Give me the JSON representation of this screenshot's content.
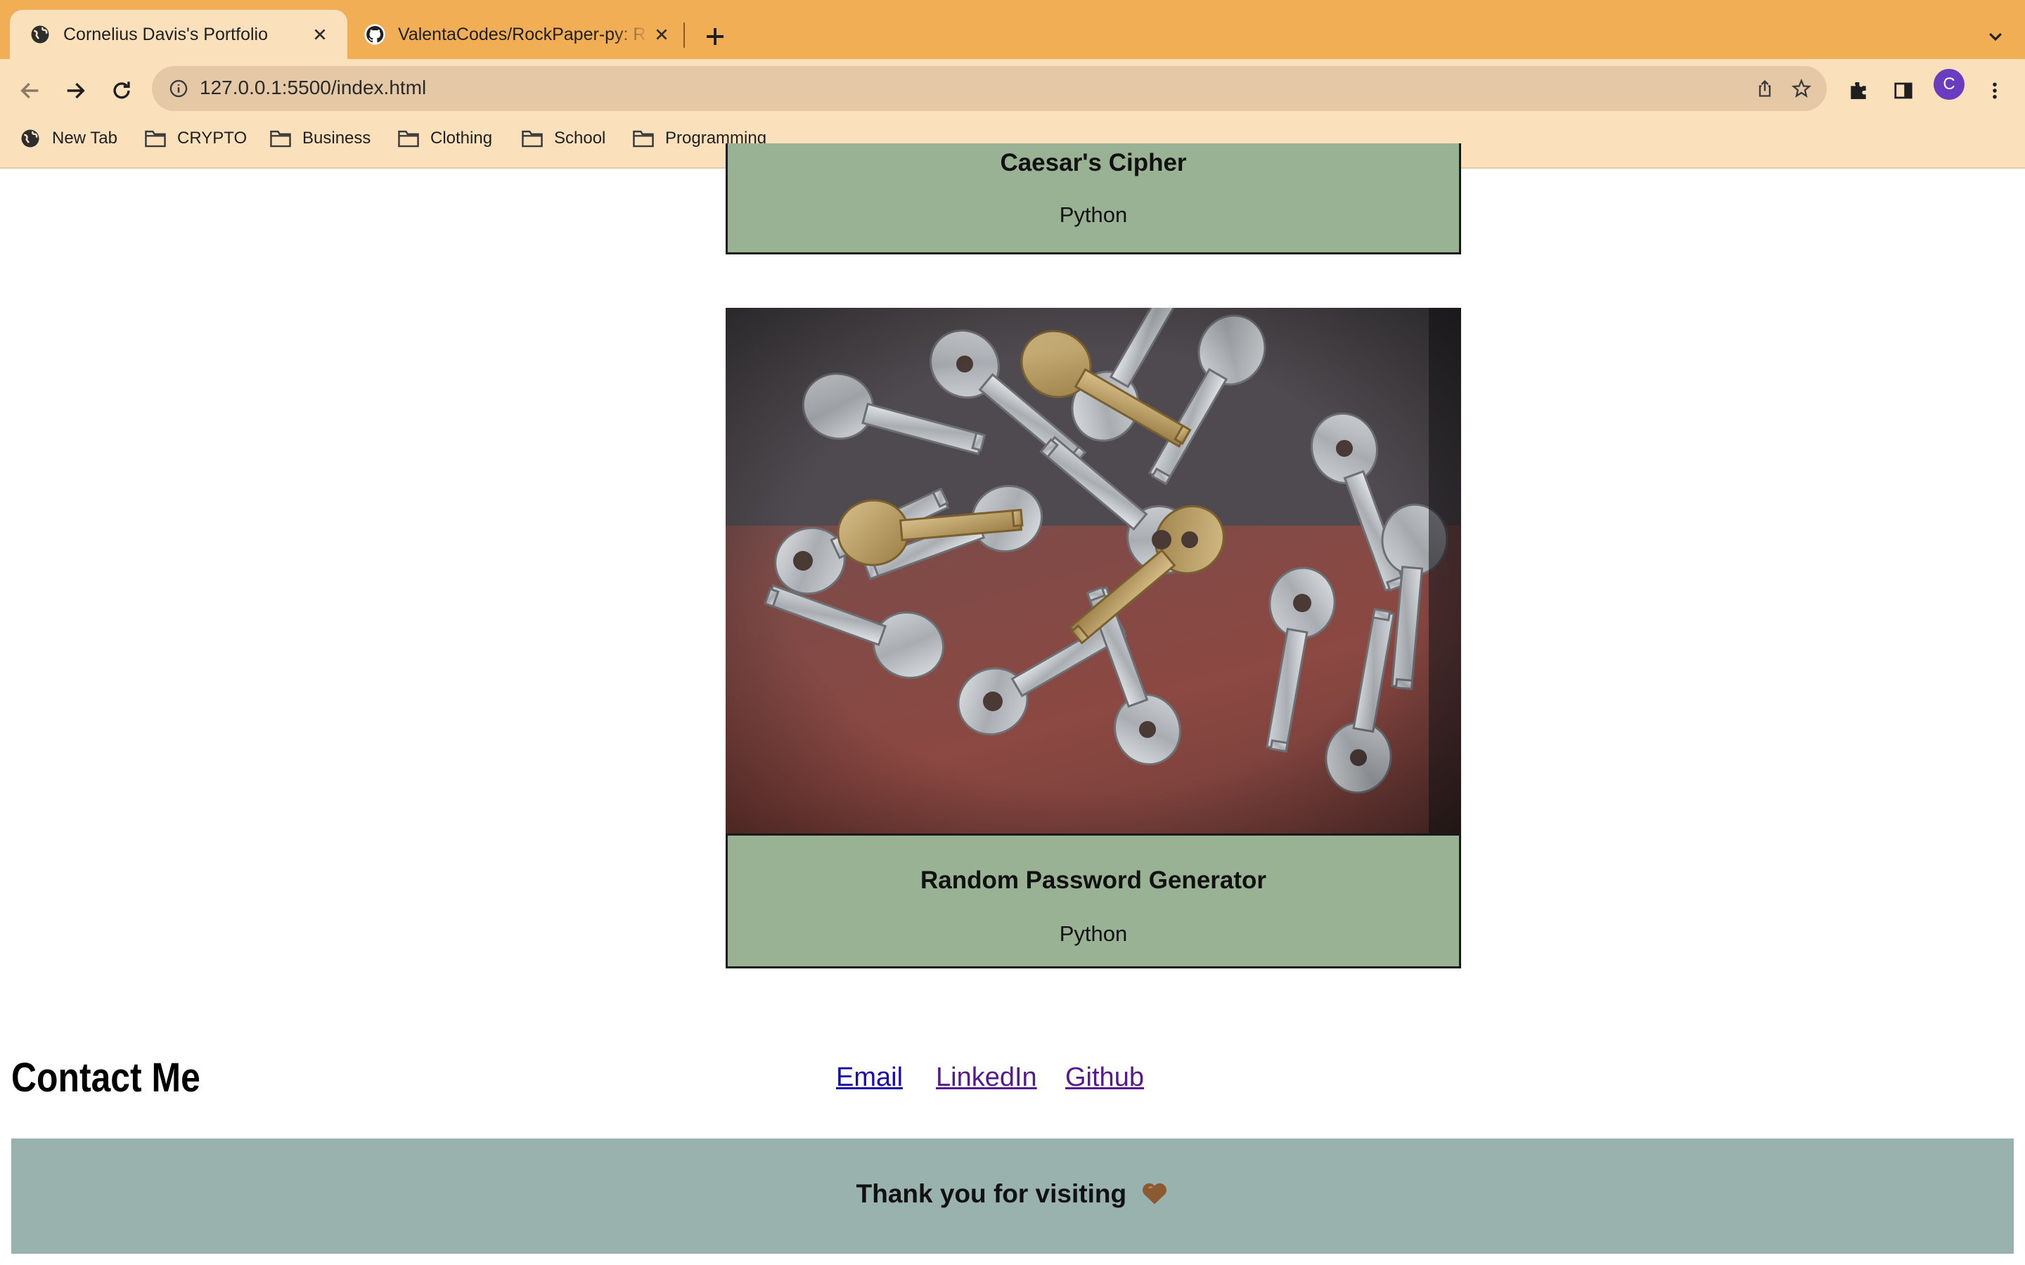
{
  "browser": {
    "tabs": [
      {
        "title": "Cornelius Davis's Portfolio",
        "active": true,
        "favicon": "globe-icon"
      },
      {
        "title": "ValentaCodes/RockPaper-py: R",
        "active": false,
        "favicon": "github-icon"
      }
    ],
    "url": "127.0.0.1:5500/index.html",
    "profile_initial": "C",
    "bookmarks": [
      {
        "label": "New Tab",
        "icon": "globe-icon"
      },
      {
        "label": "CRYPTO",
        "icon": "folder-icon"
      },
      {
        "label": "Business",
        "icon": "folder-icon"
      },
      {
        "label": "Clothing",
        "icon": "folder-icon"
      },
      {
        "label": "School",
        "icon": "folder-icon"
      },
      {
        "label": "Programming",
        "icon": "folder-icon"
      }
    ],
    "colors": {
      "tabstrip": "#f2ae55",
      "toolbar": "#fbe0bc",
      "avatar": "#6a3cbf"
    }
  },
  "projects": [
    {
      "title": "Caesar's Cipher",
      "language": "Python"
    },
    {
      "title": "Random Password Generator",
      "language": "Python",
      "image": "keys-photo"
    }
  ],
  "contact": {
    "heading": "Contact Me",
    "links": [
      "Email",
      "LinkedIn",
      "Github"
    ]
  },
  "footer": {
    "text": "Thank you for visiting",
    "icon": "brown-heart-icon"
  },
  "colors": {
    "card": "#99b294",
    "footer": "#99b2ae",
    "link": "#1a0dab",
    "visited_link": "#551a8b"
  }
}
